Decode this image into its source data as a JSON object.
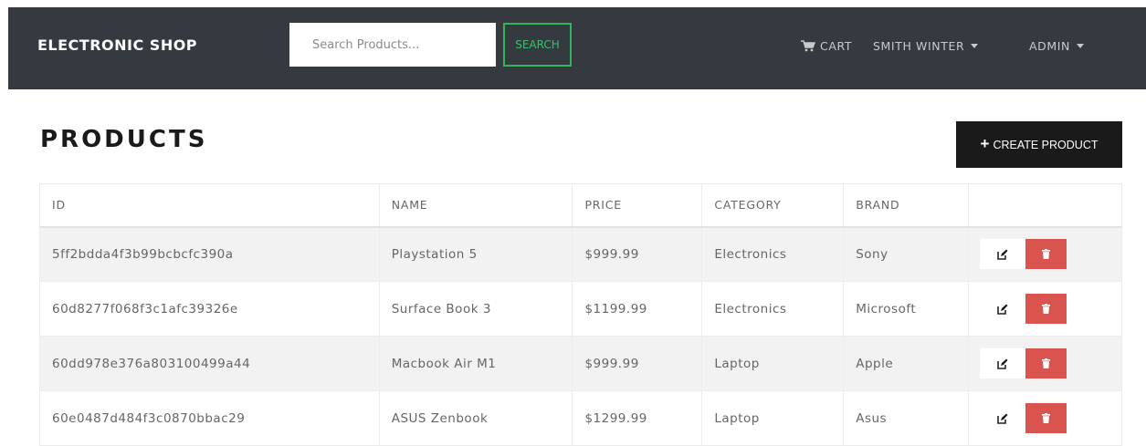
{
  "navbar": {
    "brand": "ELECTRONIC SHOP",
    "search_placeholder": "Search Products...",
    "search_label": "SEARCH",
    "cart_label": "CART",
    "user_label": "SMITH WINTER",
    "admin_label": "ADMIN"
  },
  "page": {
    "title": "PRODUCTS",
    "create_label": "CREATE PRODUCT"
  },
  "table": {
    "headers": [
      "ID",
      "NAME",
      "PRICE",
      "CATEGORY",
      "BRAND",
      ""
    ],
    "rows": [
      {
        "id": "5ff2bdda4f3b99bcbcfc390a",
        "name": "Playstation 5",
        "price": "$999.99",
        "category": "Electronics",
        "brand": "Sony"
      },
      {
        "id": "60d8277f068f3c1afc39326e",
        "name": "Surface Book 3",
        "price": "$1199.99",
        "category": "Electronics",
        "brand": "Microsoft"
      },
      {
        "id": "60dd978e376a803100499a44",
        "name": "Macbook Air M1",
        "price": "$999.99",
        "category": "Laptop",
        "brand": "Apple"
      },
      {
        "id": "60e0487d484f3c0870bbac29",
        "name": "ASUS Zenbook",
        "price": "$1299.99",
        "category": "Laptop",
        "brand": "Asus"
      }
    ]
  },
  "colors": {
    "navbar_bg": "#343a40",
    "search_accent": "#2fb65a",
    "delete_red": "#d9534f",
    "create_bg": "#1a1a1a"
  },
  "icons": {
    "cart": "cart-icon",
    "edit": "edit-icon",
    "delete": "trash-icon",
    "plus": "plus-icon",
    "caret": "caret-down-icon"
  }
}
